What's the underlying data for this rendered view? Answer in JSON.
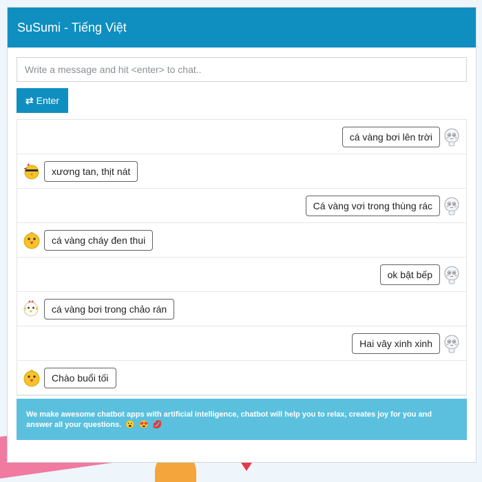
{
  "header": {
    "title": "SuSumi - Tiếng Việt"
  },
  "input": {
    "placeholder": "Write a message and hit <enter> to chat.."
  },
  "enter_button": {
    "icon": "⇄",
    "label": "Enter"
  },
  "messages": [
    {
      "from": "user",
      "text": "cá vàng bơi lên trời",
      "avatar": "user-avatar-icon"
    },
    {
      "from": "bot",
      "text": "xương tan, thịt nát",
      "avatar": "bot-sleepy-chick-icon"
    },
    {
      "from": "user",
      "text": "Cá vàng vơi trong thùng rác",
      "avatar": "user-avatar-icon"
    },
    {
      "from": "bot",
      "text": "cá vàng cháy đen thui",
      "avatar": "bot-chick-icon"
    },
    {
      "from": "user",
      "text": "ok bật bếp",
      "avatar": "user-avatar-icon"
    },
    {
      "from": "bot",
      "text": "cá vàng bơi trong chảo rán",
      "avatar": "bot-rooster-icon"
    },
    {
      "from": "user",
      "text": "Hai vây xinh xinh",
      "avatar": "user-avatar-icon"
    },
    {
      "from": "bot",
      "text": "Chào buổi tối",
      "avatar": "bot-chick-icon"
    }
  ],
  "footer": {
    "text": "We make awesome chatbot apps with artificial intelligence, chatbot will help you to relax, creates joy for you and answer all your questions.",
    "emojis": [
      "😮",
      "😍",
      "💋"
    ]
  },
  "colors": {
    "accent": "#0f8fc0",
    "footer_bg": "#5bc0de"
  }
}
